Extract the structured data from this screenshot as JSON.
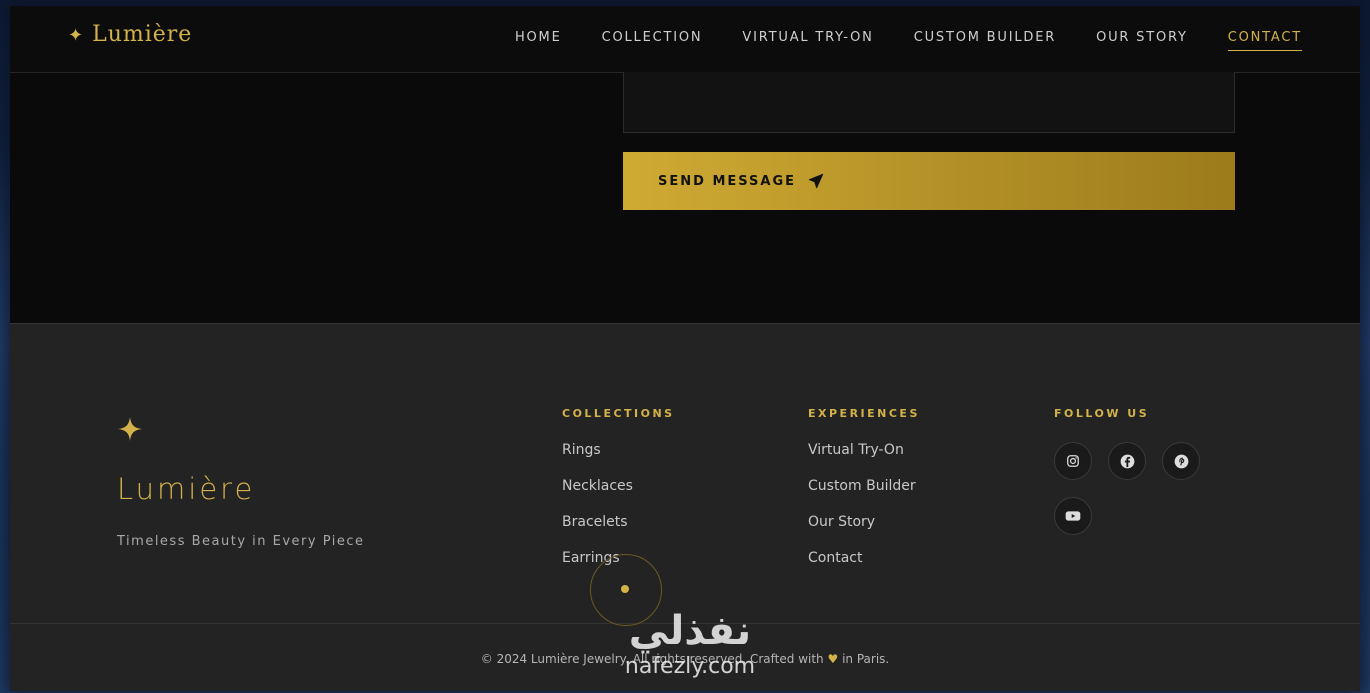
{
  "header": {
    "logo_star": "✦",
    "logo_text": "Lumière",
    "nav": [
      "HOME",
      "COLLECTION",
      "VIRTUAL TRY-ON",
      "CUSTOM BUILDER",
      "OUR STORY",
      "CONTACT"
    ],
    "active_nav": "CONTACT"
  },
  "form": {
    "send_label": "SEND MESSAGE",
    "send_icon": "paper-plane-icon"
  },
  "footer": {
    "brand": "Lumière",
    "tagline": "Timeless Beauty in Every Piece",
    "collections": {
      "heading": "COLLECTIONS",
      "links": [
        "Rings",
        "Necklaces",
        "Bracelets",
        "Earrings"
      ]
    },
    "experiences": {
      "heading": "EXPERIENCES",
      "links": [
        "Virtual Try-On",
        "Custom Builder",
        "Our Story",
        "Contact"
      ]
    },
    "follow": {
      "heading": "FOLLOW US",
      "icons": [
        "instagram-icon",
        "facebook-icon",
        "pinterest-icon",
        "youtube-icon"
      ]
    },
    "copyright_pre": "© 2024 Lumière Jewelry. All rights reserved. Crafted with",
    "heart": "♥",
    "copyright_post": "in Paris."
  },
  "watermark": {
    "arabic": "نفذلي",
    "latin": "nafezly.com"
  },
  "colors": {
    "accent": "#d4b24a",
    "background": "#0a0a0a",
    "footer_bg": "#232323"
  }
}
